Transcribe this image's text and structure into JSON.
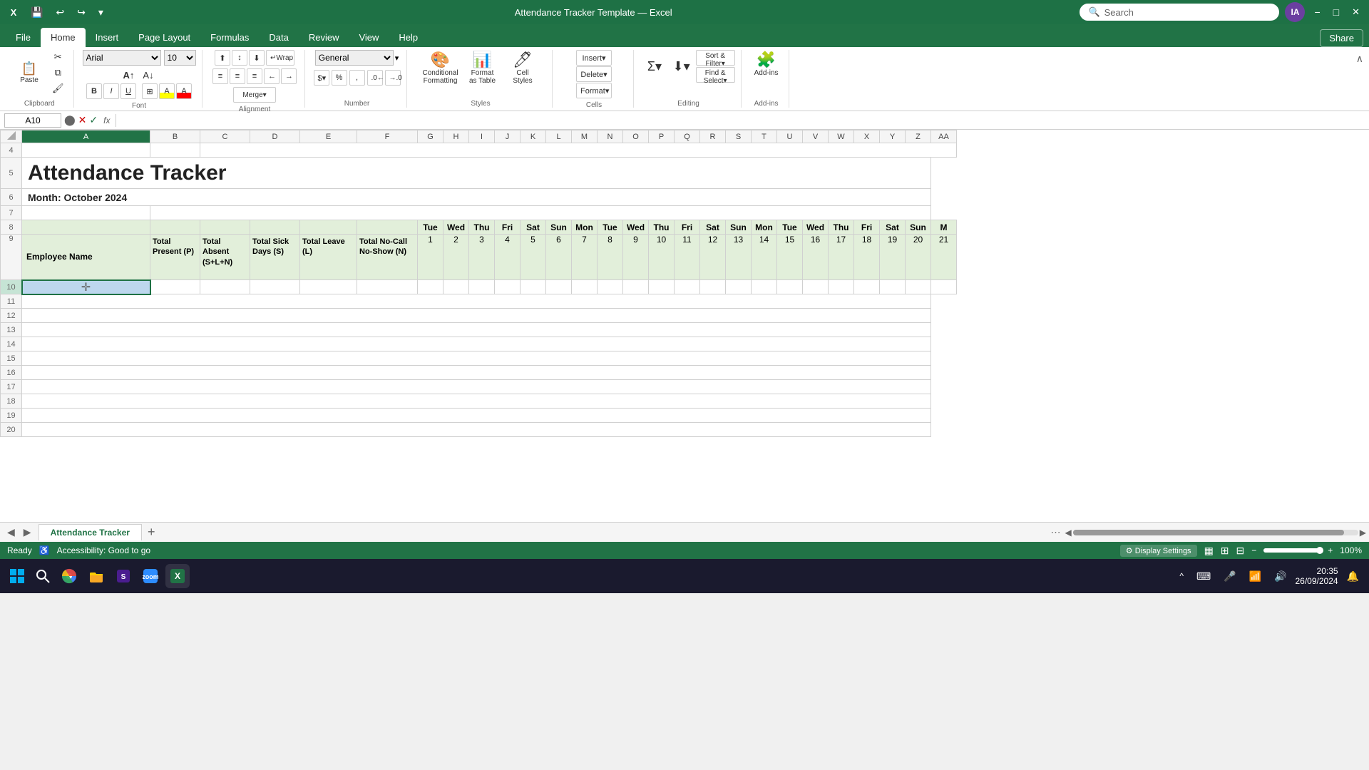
{
  "titlebar": {
    "app_icon": "X",
    "file_name": "Attendance Tracker Template — Excel",
    "search_placeholder": "Search",
    "min_label": "−",
    "max_label": "□",
    "close_label": "✕"
  },
  "ribbon_tabs": [
    "File",
    "Home",
    "Insert",
    "Page Layout",
    "Formulas",
    "Data",
    "Review",
    "View",
    "Help"
  ],
  "active_tab": "Home",
  "ribbon": {
    "clipboard_label": "Clipboard",
    "paste_label": "Paste",
    "font_label": "Font",
    "font_value": "Arial",
    "font_size": "10",
    "alignment_label": "Alignment",
    "number_label": "Number",
    "number_format": "General",
    "styles_label": "Styles",
    "cond_fmt_label": "Conditional Formatting",
    "fmt_table_label": "Format as Table",
    "cell_styles_label": "Cell Styles",
    "cells_label": "Cells",
    "insert_label": "Insert",
    "delete_label": "Delete",
    "format_label": "Format",
    "editing_label": "Editing",
    "sort_filter_label": "Sort & Filter",
    "find_select_label": "Find & Select",
    "addins_label": "Add-ins",
    "share_label": "Share"
  },
  "formulabar": {
    "cell_ref": "A10",
    "fx": "fx"
  },
  "sheet": {
    "title": "Attendance Tracker",
    "month": "Month: October 2024",
    "columns": [
      "A",
      "B",
      "C",
      "D",
      "E",
      "F",
      "G",
      "H",
      "I",
      "J",
      "K",
      "L",
      "M",
      "N",
      "O",
      "P",
      "Q",
      "R",
      "S",
      "T",
      "U",
      "V",
      "W",
      "X",
      "Y",
      "Z",
      "AA"
    ],
    "headers": {
      "employee_name": "Employee Name",
      "total_present": "Total Present (P)",
      "total_absent": "Total Absent (S+L+N)",
      "total_sick": "Total Sick Days (S)",
      "total_leave": "Total Leave (L)",
      "total_nocall": "Total No-Call No-Show (N)"
    },
    "day_names": [
      "Tue",
      "Wed",
      "Thu",
      "Fri",
      "Sat",
      "Sun",
      "Mon",
      "Tue",
      "Wed",
      "Thu",
      "Fri",
      "Sat",
      "Sun",
      "Mon",
      "Tue",
      "Wed",
      "Thu",
      "Fri",
      "Sat",
      "Sun",
      "M"
    ],
    "day_nums": [
      "1",
      "2",
      "3",
      "4",
      "5",
      "6",
      "7",
      "8",
      "9",
      "10",
      "11",
      "12",
      "13",
      "14",
      "15",
      "16",
      "17",
      "18",
      "19",
      "20",
      "21"
    ]
  },
  "tabbar": {
    "sheet_name": "Attendance Tracker",
    "add_label": "+"
  },
  "statusbar": {
    "ready": "Ready",
    "accessibility": "Accessibility: Good to go",
    "display_settings": "Display Settings",
    "zoom": "100%"
  },
  "taskbar": {
    "time": "20:35",
    "date": "26/09/2024"
  }
}
